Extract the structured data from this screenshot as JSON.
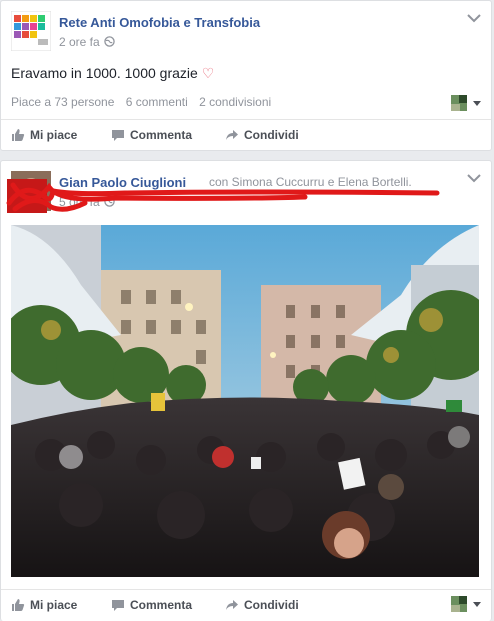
{
  "post1": {
    "page_name": "Rete Anti Omofobia e Transfobia",
    "timestamp": "2 ore fa",
    "text": "Eravamo in 1000. 1000 grazie",
    "heart": "♡",
    "likes": "Piace a 73 persone",
    "comments": "6 commenti",
    "shares": "2 condivisioni",
    "actions": {
      "like": "Mi piace",
      "comment": "Commenta",
      "share": "Condividi"
    }
  },
  "post2": {
    "author": "Gian Paolo Ciuglioni",
    "with_text": "con Simona Cuccurru e Elena Bortelli.",
    "timestamp": "5 ore fa",
    "actions": {
      "like": "Mi piace",
      "comment": "Commenta",
      "share": "Condividi"
    }
  },
  "colors": {
    "link_blue": "#365899",
    "muted": "#90949c",
    "redaction": "#e01919",
    "heart": "#e55a6a"
  },
  "icons": [
    "globe-icon",
    "thumbs-up-icon",
    "comment-icon",
    "share-icon",
    "chevron-down-icon"
  ]
}
